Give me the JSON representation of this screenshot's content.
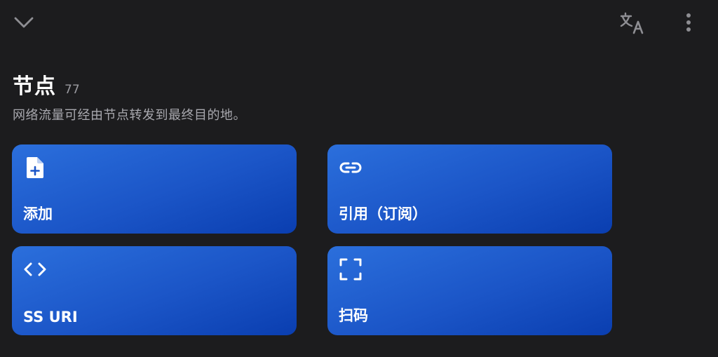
{
  "header": {
    "collapse_icon": "chevron-down-icon",
    "translate_icon": "translate-icon",
    "more_icon": "more-vertical-icon"
  },
  "section": {
    "title": "节点",
    "count": "77",
    "description": "网络流量可经由节点转发到最终目的地。"
  },
  "actions": [
    {
      "label": "添加",
      "icon": "file-add-icon"
    },
    {
      "label": "引用（订阅）",
      "icon": "link-icon"
    },
    {
      "label": "SS URI",
      "icon": "code-icon"
    },
    {
      "label": "扫码",
      "icon": "scan-icon"
    }
  ],
  "colors": {
    "background": "#1c1c1e",
    "card_start": "#2b6fdc",
    "card_end": "#0a3eb0",
    "secondary_text": "#a8a8ae"
  }
}
